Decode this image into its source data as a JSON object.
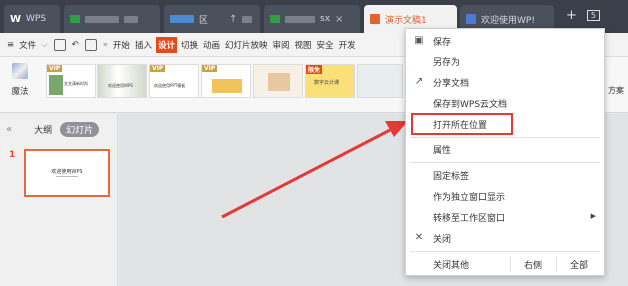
{
  "tabbar": {
    "home_label": "WPS",
    "tab3_label": "区",
    "tab5_label": "sx",
    "active_tab_label": "演示文稿1",
    "welcome_tab_label": "欢迎使用WP!",
    "new_tab": "+",
    "badge": "5",
    "colors": {
      "bg": "#3a3f4a",
      "accent": "#e0622f"
    }
  },
  "menubar": {
    "file_label": "文件",
    "items": [
      "开始",
      "插入",
      "设计",
      "切换",
      "动画",
      "幻灯片放映",
      "审阅",
      "视图",
      "安全",
      "开发"
    ],
    "active_item": "设计"
  },
  "ribbon": {
    "magic_label": "魔法",
    "vip_badge": "VIP",
    "free_badge": "限免",
    "thumbnails": [
      {
        "caption": "文艺清新时尚"
      },
      {
        "caption": "欢迎使用WPS"
      },
      {
        "caption": "欢迎使用PPT模板"
      },
      {
        "caption": "数字云计课"
      },
      {
        "caption": ""
      }
    ],
    "right_label": "方案"
  },
  "leftpanel": {
    "collapse_icon": "«",
    "outline_tab": "大纲",
    "slides_tab": "幻灯片",
    "slide_number": "1",
    "slide_title": "欢迎使用WPS"
  },
  "context_menu": {
    "items": [
      {
        "label": "保存",
        "icon": "save-icon"
      },
      {
        "label": "另存为",
        "icon": ""
      },
      {
        "label": "分享文档",
        "icon": "share-icon"
      },
      {
        "label": "保存到WPS云文档",
        "icon": ""
      },
      {
        "label": "打开所在位置",
        "icon": ""
      },
      {
        "label": "属性",
        "icon": ""
      },
      {
        "label": "固定标签",
        "icon": ""
      },
      {
        "label": "作为独立窗口显示",
        "icon": ""
      },
      {
        "label": "转移至工作区窗口",
        "icon": ""
      },
      {
        "label": "关闭",
        "icon": "close-icon"
      }
    ],
    "bottom": {
      "close_others": "关闭其他",
      "right": "右侧",
      "all": "全部"
    },
    "highlight_color": "#e53935"
  }
}
